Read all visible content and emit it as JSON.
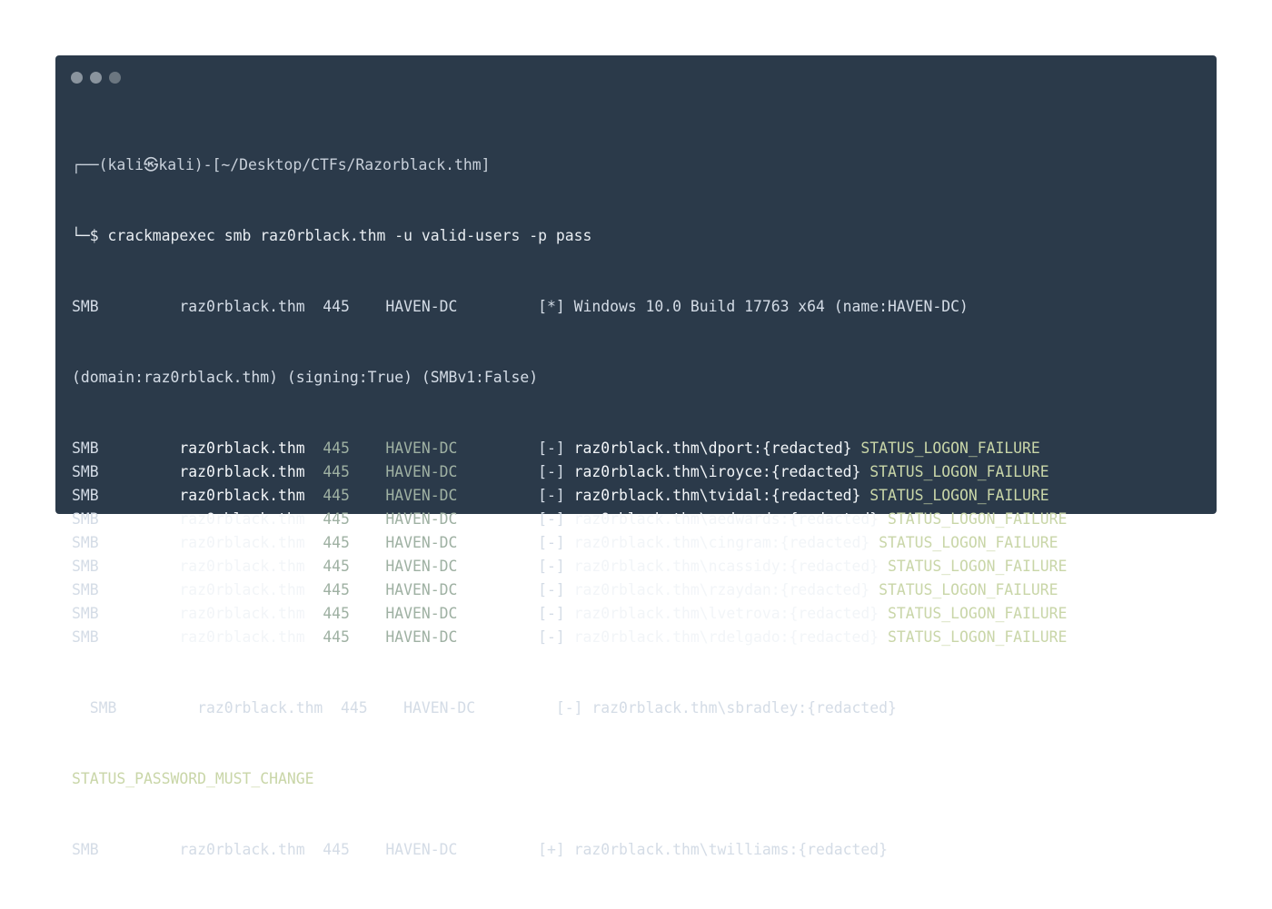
{
  "window": {
    "dots": [
      "#8a949e",
      "#8a949e",
      "#6b7680"
    ]
  },
  "prompt": {
    "top": "┌──(kali㉿kali)-[~/Desktop/CTFs/Razorblack.thm]",
    "bottom": "└─$ crackmapexec smb raz0rblack.thm -u valid-users -p pass"
  },
  "output": {
    "info_line": "SMB         raz0rblack.thm  445    HAVEN-DC         [*] Windows 10.0 Build 17763 x64 (name:HAVEN-DC)",
    "info_line2": "(domain:raz0rblack.thm) (signing:True) (SMBv1:False)",
    "rows": [
      {
        "proto": "SMB",
        "host": "raz0rblack.thm",
        "port": "445",
        "name": "HAVEN-DC",
        "mark": "[-]",
        "cred": "raz0rblack.thm\\dport:{redacted}",
        "status": "STATUS_LOGON_FAILURE"
      },
      {
        "proto": "SMB",
        "host": "raz0rblack.thm",
        "port": "445",
        "name": "HAVEN-DC",
        "mark": "[-]",
        "cred": "raz0rblack.thm\\iroyce:{redacted}",
        "status": "STATUS_LOGON_FAILURE"
      },
      {
        "proto": "SMB",
        "host": "raz0rblack.thm",
        "port": "445",
        "name": "HAVEN-DC",
        "mark": "[-]",
        "cred": "raz0rblack.thm\\tvidal:{redacted}",
        "status": "STATUS_LOGON_FAILURE"
      },
      {
        "proto": "SMB",
        "host": "raz0rblack.thm",
        "port": "445",
        "name": "HAVEN-DC",
        "mark": "[-]",
        "cred": "raz0rblack.thm\\aedwards:{redacted}",
        "status": "STATUS_LOGON_FAILURE"
      },
      {
        "proto": "SMB",
        "host": "raz0rblack.thm",
        "port": "445",
        "name": "HAVEN-DC",
        "mark": "[-]",
        "cred": "raz0rblack.thm\\cingram:{redacted}",
        "status": "STATUS_LOGON_FAILURE"
      },
      {
        "proto": "SMB",
        "host": "raz0rblack.thm",
        "port": "445",
        "name": "HAVEN-DC",
        "mark": "[-]",
        "cred": "raz0rblack.thm\\ncassidy:{redacted}",
        "status": "STATUS_LOGON_FAILURE"
      },
      {
        "proto": "SMB",
        "host": "raz0rblack.thm",
        "port": "445",
        "name": "HAVEN-DC",
        "mark": "[-]",
        "cred": "raz0rblack.thm\\rzaydan:{redacted}",
        "status": "STATUS_LOGON_FAILURE"
      },
      {
        "proto": "SMB",
        "host": "raz0rblack.thm",
        "port": "445",
        "name": "HAVEN-DC",
        "mark": "[-]",
        "cred": "raz0rblack.thm\\lvetrova:{redacted}",
        "status": "STATUS_LOGON_FAILURE"
      },
      {
        "proto": "SMB",
        "host": "raz0rblack.thm",
        "port": "445",
        "name": "HAVEN-DC",
        "mark": "[-]",
        "cred": "raz0rblack.thm\\rdelgado:{redacted}",
        "status": "STATUS_LOGON_FAILURE"
      }
    ],
    "sbradley_line": "  SMB         raz0rblack.thm  445    HAVEN-DC         [-] raz0rblack.thm\\sbradley:{redacted}",
    "sbradley_status": "STATUS_PASSWORD_MUST_CHANGE",
    "last_line": "SMB         raz0rblack.thm  445    HAVEN-DC         [+] raz0rblack.thm\\twilliams:{redacted}"
  }
}
